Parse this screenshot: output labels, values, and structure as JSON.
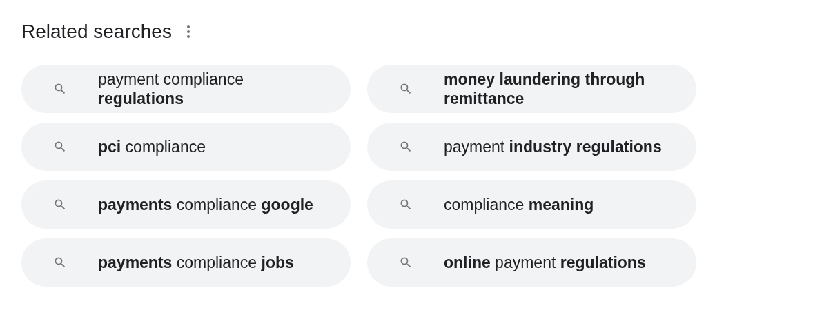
{
  "title": "Related searches",
  "items": [
    {
      "text": "payment compliance **regulations**"
    },
    {
      "text": "**money laundering through remittance**"
    },
    {
      "text": "**pci** compliance"
    },
    {
      "text": "payment **industry regulations**"
    },
    {
      "text": "**payments** compliance **google**"
    },
    {
      "text": "compliance **meaning**"
    },
    {
      "text": "**payments** compliance **jobs**"
    },
    {
      "text": "**online** payment **regulations**"
    }
  ]
}
